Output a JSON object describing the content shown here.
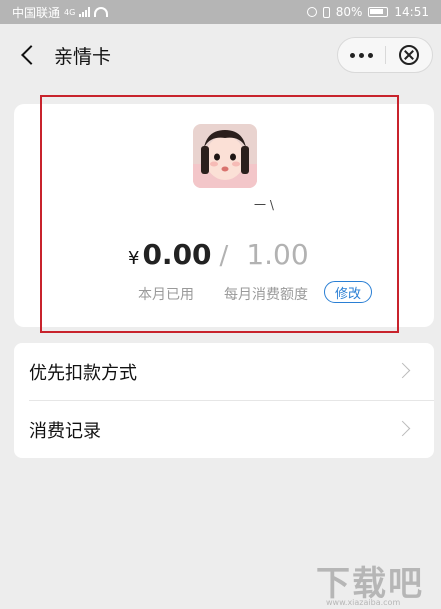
{
  "status_bar": {
    "carrier": "中国联通",
    "network": "4G",
    "battery": "80%",
    "time": "14:51"
  },
  "header": {
    "title": "亲情卡",
    "back_icon": "chevron-left-icon",
    "more_icon": "more-dots-icon",
    "close_icon": "close-circle-icon"
  },
  "card": {
    "nickname": "一 \\",
    "currency": "¥",
    "used_amount": "0.00",
    "slash": "/",
    "monthly_limit": "1.00",
    "used_label": "本月已用",
    "limit_label": "每月消费额度",
    "edit_label": "修改",
    "accent_color": "#2a7fd4",
    "highlight_color": "#c8232c"
  },
  "menu": {
    "items": [
      {
        "label": "优先扣款方式"
      },
      {
        "label": "消费记录"
      }
    ]
  },
  "watermark": {
    "text": "下载吧",
    "url": "www.xiazaiba.com"
  }
}
